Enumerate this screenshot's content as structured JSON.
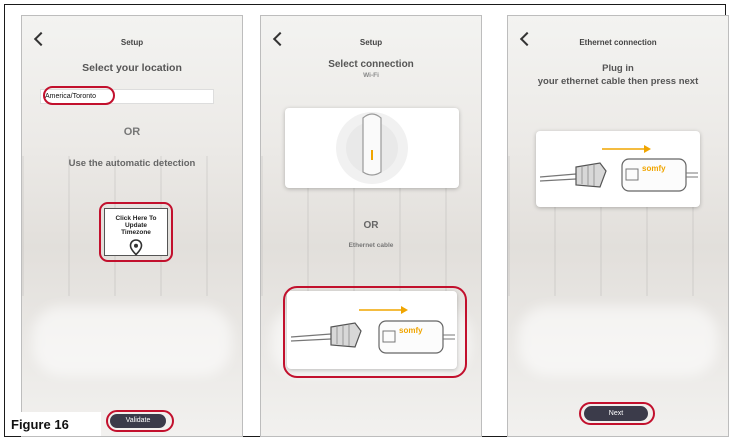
{
  "screen1": {
    "header": "Setup",
    "title": "Select your location",
    "location_value": "America/Toronto",
    "or_text": "OR",
    "auto_text": "Use the automatic detection",
    "tz_button": "Click Here To Update Timezone",
    "validate_label": "Validate"
  },
  "screen2": {
    "header": "Setup",
    "title": "Select connection",
    "wifi_label": "Wi-Fi",
    "or_text": "OR",
    "ethernet_label": "Ethernet cable"
  },
  "screen3": {
    "header": "Ethernet connection",
    "title_line1": "Plug in",
    "title_line2": "your ethernet cable then press next",
    "next_label": "Next"
  },
  "device_brand": "somfy",
  "figure_label": "Figure 16",
  "icons": [
    "chevron-left-icon",
    "map-pin-icon",
    "wifi-box-icon",
    "ethernet-cable-icon",
    "arrow-right-icon"
  ],
  "colors": {
    "highlight": "#c2102d",
    "arrow": "#f0a500",
    "button": "#3b3b4a",
    "brand": "#f0a500"
  }
}
